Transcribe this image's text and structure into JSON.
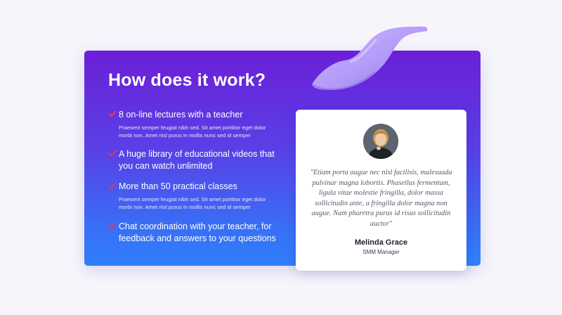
{
  "section": {
    "title": "How does it work?",
    "features": [
      {
        "title": "8 on-line lectures with a teacher",
        "description": "Praesent semper feugiat nibh sed. Sit amet porttitor eget dolor morbi non. Amet nisl purus in mollis nunc sed id semper"
      },
      {
        "title": "A huge library of educational videos that you can watch unlimited",
        "description": ""
      },
      {
        "title": "More than 50 practical classes",
        "description": "Praesent semper feugiat nibh sed. Sit amet porttitor eget dolor morbi non. Amet nisl purus in mollis nunc sed id semper"
      },
      {
        "title": "Chat coordination with your teacher, for feedback and answers to your questions",
        "description": ""
      }
    ]
  },
  "testimonial": {
    "quote": "\"Etiam porta augue nec nisl facilisis, malesuada pulvinar magna lobortis. Phasellus fermentum, ligula vitae molestie fringilla, dolor massa sollicitudin ante, a fringilla dolor magna non augue. Nam pharetra purus id risus sollicitudin auctor\"",
    "name": "Melinda Grace",
    "role": "SMM Manager"
  },
  "icons": {
    "feature_bullet": "check-icon",
    "decoration": "wave-ribbon-3d"
  },
  "colors": {
    "gradient_top": "#6b1fd6",
    "gradient_bottom": "#2f80fb",
    "check": "#e8325a",
    "ribbon": "#b79cf9"
  }
}
